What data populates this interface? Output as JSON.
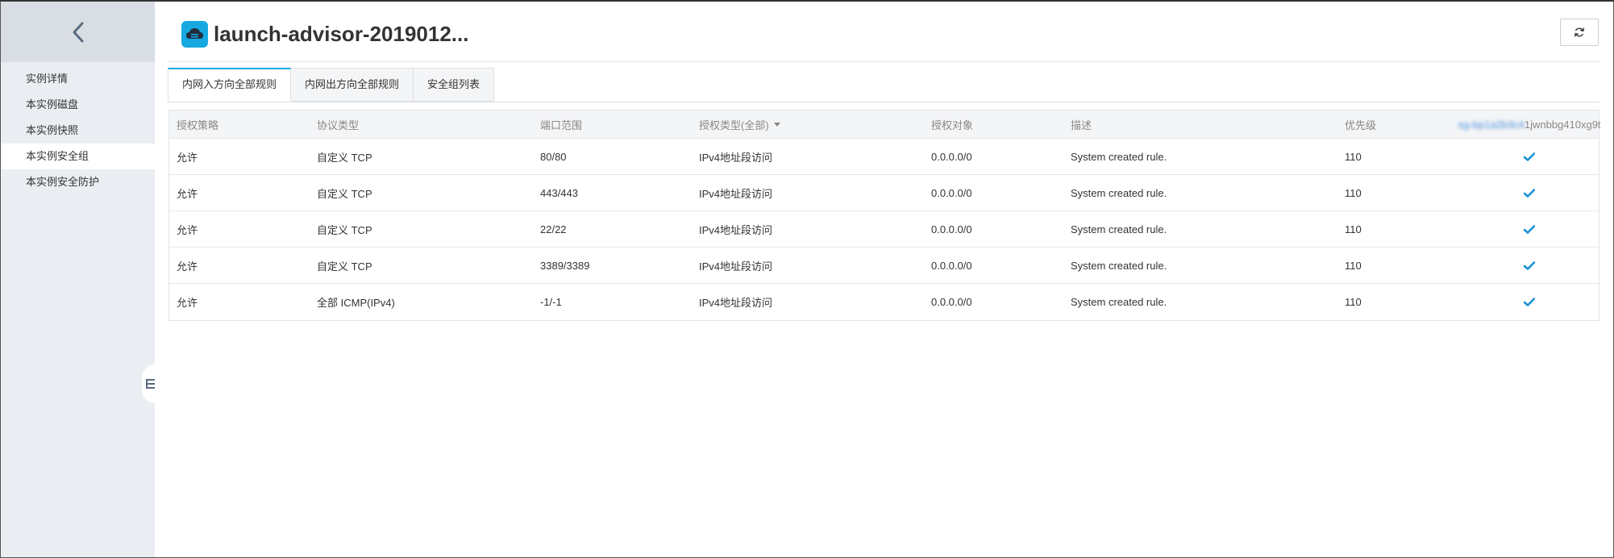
{
  "sidebar": {
    "items": [
      {
        "label": "实例详情"
      },
      {
        "label": "本实例磁盘"
      },
      {
        "label": "本实例快照"
      },
      {
        "label": "本实例安全组",
        "active": true
      },
      {
        "label": "本实例安全防护"
      }
    ],
    "back_icon": "chevron-left-icon",
    "collapse_icon": "collapse-menu-icon"
  },
  "header": {
    "title": "launch-advisor-2019012...",
    "app_icon": "cloud-server-icon",
    "refresh_icon": "refresh-icon"
  },
  "tabs": [
    {
      "label": "内网入方向全部规则",
      "active": true
    },
    {
      "label": "内网出方向全部规则"
    },
    {
      "label": "安全组列表"
    }
  ],
  "table": {
    "columns": [
      "授权策略",
      "协议类型",
      "端口范围",
      "授权类型(全部)",
      "授权对象",
      "描述",
      "优先级"
    ],
    "sg_column": {
      "blurred": "sg-bp1a2b3c4",
      "visible": "1jwnbbg410xg9t"
    },
    "rows": [
      {
        "policy": "允许",
        "protocol": "自定义 TCP",
        "port": "80/80",
        "auth_type": "IPv4地址段访问",
        "target": "0.0.0.0/0",
        "desc": "System created rule.",
        "priority": "110",
        "enabled": true
      },
      {
        "policy": "允许",
        "protocol": "自定义 TCP",
        "port": "443/443",
        "auth_type": "IPv4地址段访问",
        "target": "0.0.0.0/0",
        "desc": "System created rule.",
        "priority": "110",
        "enabled": true
      },
      {
        "policy": "允许",
        "protocol": "自定义 TCP",
        "port": "22/22",
        "auth_type": "IPv4地址段访问",
        "target": "0.0.0.0/0",
        "desc": "System created rule.",
        "priority": "110",
        "enabled": true
      },
      {
        "policy": "允许",
        "protocol": "自定义 TCP",
        "port": "3389/3389",
        "auth_type": "IPv4地址段访问",
        "target": "0.0.0.0/0",
        "desc": "System created rule.",
        "priority": "110",
        "enabled": true
      },
      {
        "policy": "允许",
        "protocol": "全部 ICMP(IPv4)",
        "port": "-1/-1",
        "auth_type": "IPv4地址段访问",
        "target": "0.0.0.0/0",
        "desc": "System created rule.",
        "priority": "110",
        "enabled": true
      }
    ]
  },
  "colors": {
    "accent": "#17a8e0",
    "link": "#0070cc",
    "check": "#1a8fd6",
    "sidebar_bg": "#eaedf1",
    "sidebar_head_bg": "#d9dee4"
  }
}
